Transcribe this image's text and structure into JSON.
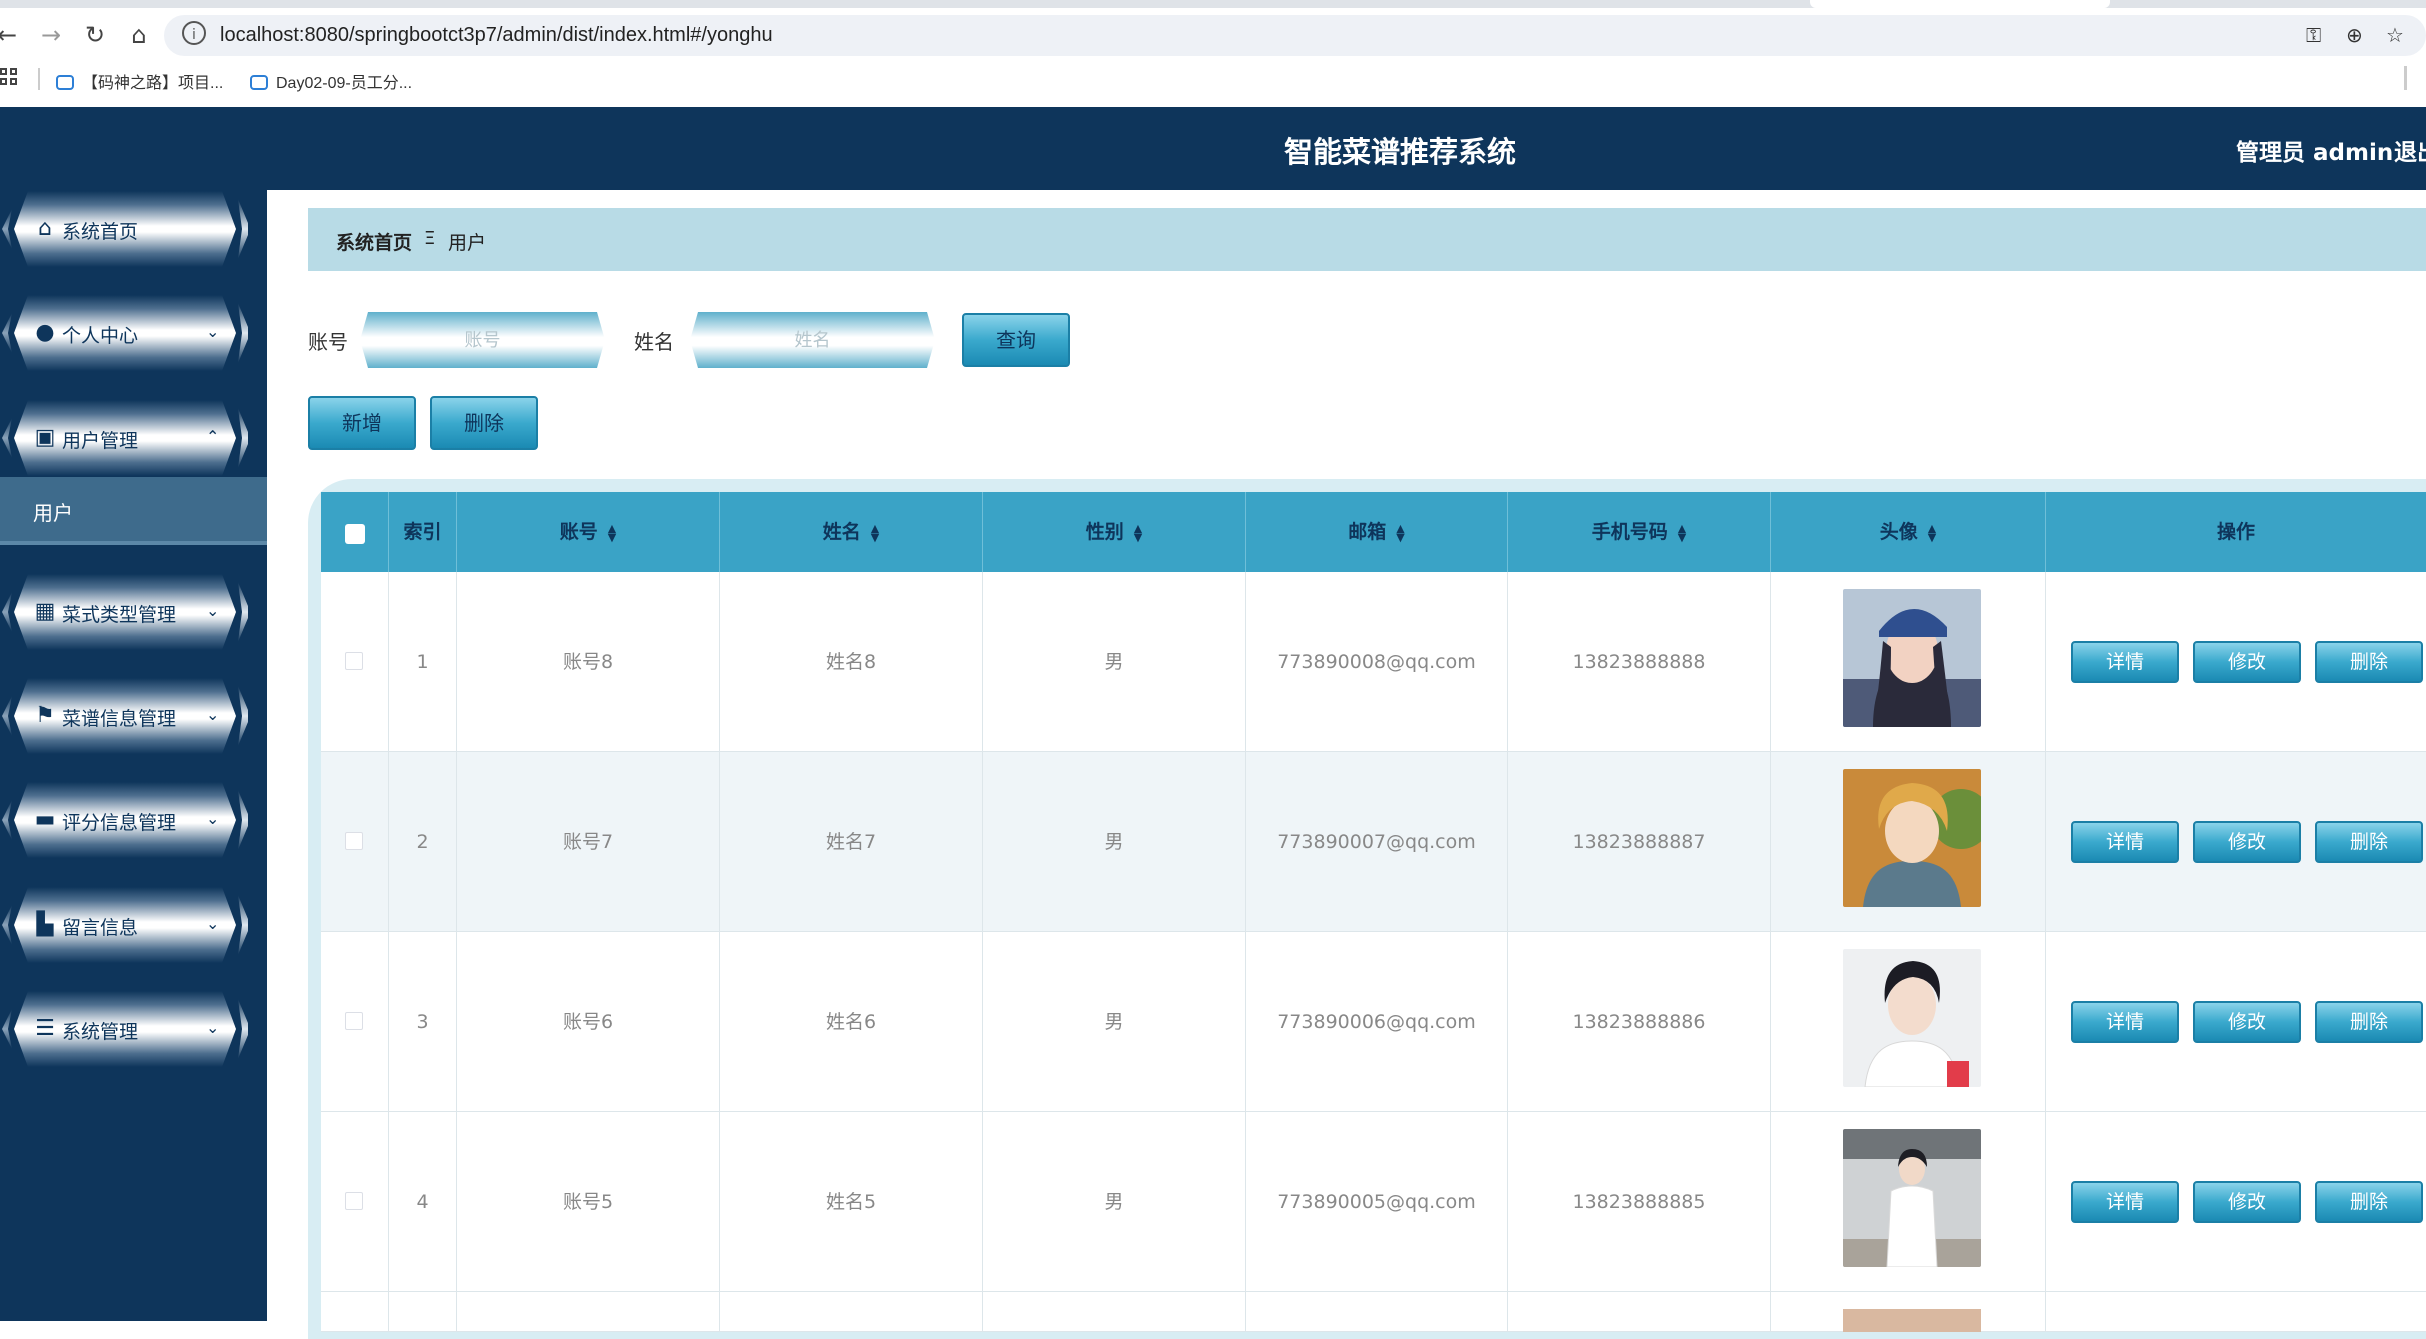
{
  "browser": {
    "url": "localhost:8080/springbootct3p7/admin/dist/index.html#/yonghu",
    "bookmarks": [
      "【码神之路】项目...",
      "Day02-09-员工分..."
    ]
  },
  "header": {
    "title": "智能菜谱推荐系统",
    "user": "管理员 admin",
    "logout": "退出"
  },
  "sidebar": {
    "items": [
      {
        "label": "系统首页",
        "icon": "home-icon"
      },
      {
        "label": "个人中心",
        "icon": "user-icon"
      },
      {
        "label": "用户管理",
        "icon": "clipboard-icon"
      },
      {
        "label": "菜式类型管理",
        "icon": "grid-icon"
      },
      {
        "label": "菜谱信息管理",
        "icon": "flag-icon"
      },
      {
        "label": "评分信息管理",
        "icon": "briefcase-icon"
      },
      {
        "label": "留言信息",
        "icon": "book-icon"
      },
      {
        "label": "系统管理",
        "icon": "list-icon"
      }
    ],
    "submenu": "用户"
  },
  "breadcrumb": {
    "home": "系统首页",
    "separator": "Ξ",
    "current": "用户"
  },
  "search": {
    "account_label": "账号",
    "account_placeholder": "账号",
    "name_label": "姓名",
    "name_placeholder": "姓名",
    "search_button": "查询"
  },
  "actions": {
    "add": "新增",
    "delete": "删除"
  },
  "table": {
    "headers": [
      "索引",
      "账号",
      "姓名",
      "性别",
      "邮箱",
      "手机号码",
      "头像",
      "操作"
    ],
    "rows": [
      {
        "index": "1",
        "account": "账号8",
        "name": "姓名8",
        "gender": "男",
        "email": "773890008@qq.com",
        "phone": "13823888888"
      },
      {
        "index": "2",
        "account": "账号7",
        "name": "姓名7",
        "gender": "男",
        "email": "773890007@qq.com",
        "phone": "13823888887"
      },
      {
        "index": "3",
        "account": "账号6",
        "name": "姓名6",
        "gender": "男",
        "email": "773890006@qq.com",
        "phone": "13823888886"
      },
      {
        "index": "4",
        "account": "账号5",
        "name": "姓名5",
        "gender": "男",
        "email": "773890005@qq.com",
        "phone": "13823888885"
      }
    ],
    "row_actions": [
      "详情",
      "修改",
      "删除"
    ]
  },
  "colors": {
    "sidebar_bg": "#0e355b",
    "header_bg": "#0e355b",
    "breadcrumb_bg": "#b8dbe6",
    "table_header_bg": "#3aa3c6",
    "button_accent": "#3aa9cd"
  }
}
